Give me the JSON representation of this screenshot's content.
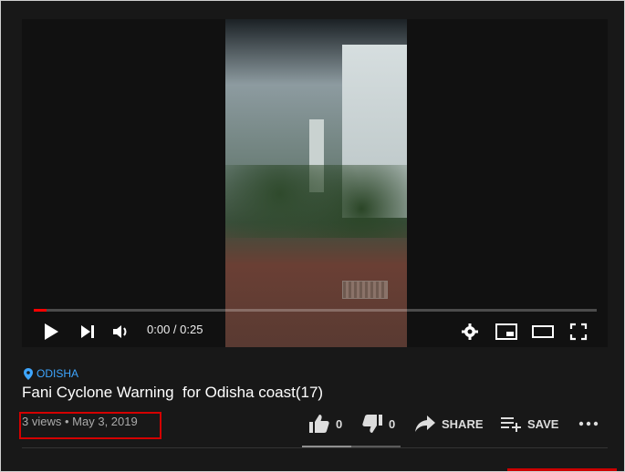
{
  "player": {
    "time_display": "0:00 / 0:25",
    "progress_fraction": 0.022
  },
  "video": {
    "location_tag": "ODISHA",
    "title": "Fani Cyclone Warning  for Odisha coast(17)",
    "views": "3 views",
    "separator": "•",
    "date": "May 3, 2019"
  },
  "actions": {
    "like_count": "0",
    "dislike_count": "0",
    "share_label": "SHARE",
    "save_label": "SAVE",
    "like_fraction": 0.5
  },
  "colors": {
    "accent_link": "#3ea6ff",
    "progress": "#ff0000",
    "highlight_box": "#d40000"
  },
  "icons": [
    "location-pin-icon",
    "play-icon",
    "next-icon",
    "volume-icon",
    "settings-gear-icon",
    "miniplayer-icon",
    "theater-mode-icon",
    "fullscreen-icon",
    "thumbs-up-icon",
    "thumbs-down-icon",
    "share-arrow-icon",
    "playlist-add-icon",
    "more-options-icon"
  ]
}
